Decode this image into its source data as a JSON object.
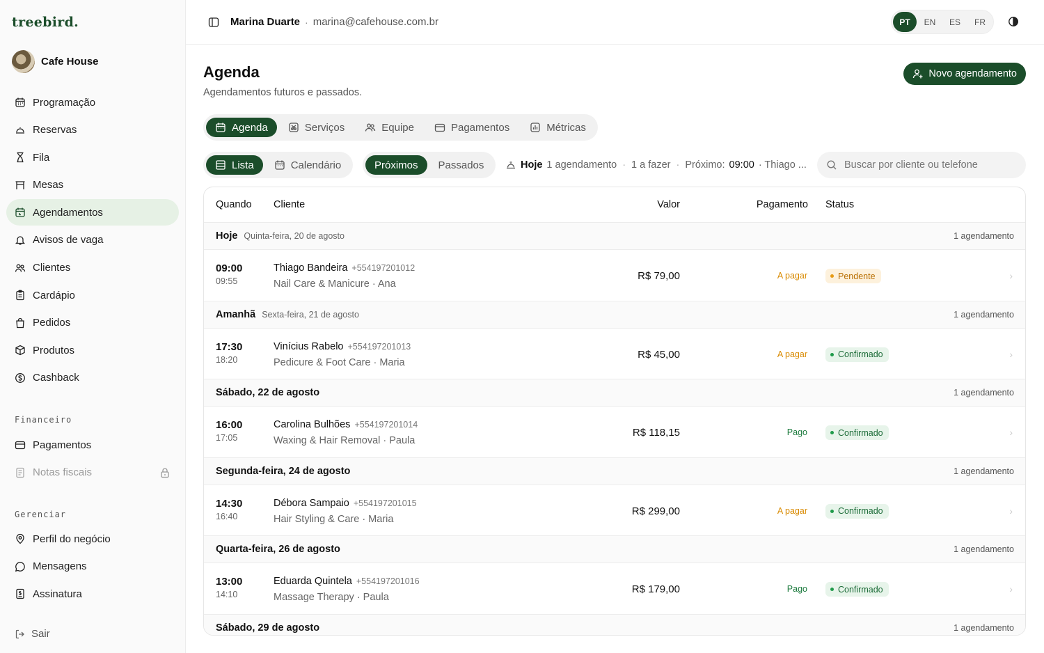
{
  "brand": {
    "logo": "treebird.",
    "business": "Cafe House"
  },
  "colors": {
    "brand": "#1b4d2a",
    "active_bg": "#e6f1e5",
    "pending": "#d98a00",
    "pending_bg": "#fdf1dc",
    "confirmed": "#1b7a3d",
    "confirmed_bg": "#e7f4ea",
    "paid": "#1b7a3d",
    "to_pay": "#d98a00"
  },
  "sidebar": {
    "items": [
      {
        "label": "Programação",
        "icon": "calendar-icon"
      },
      {
        "label": "Reservas",
        "icon": "cloche-icon"
      },
      {
        "label": "Fila",
        "icon": "hourglass-icon"
      },
      {
        "label": "Mesas",
        "icon": "table-icon"
      },
      {
        "label": "Agendamentos",
        "icon": "calendar-clock-icon"
      },
      {
        "label": "Avisos de vaga",
        "icon": "bell-icon"
      },
      {
        "label": "Clientes",
        "icon": "users-icon"
      },
      {
        "label": "Cardápio",
        "icon": "clipboard-icon"
      },
      {
        "label": "Pedidos",
        "icon": "bag-icon"
      },
      {
        "label": "Produtos",
        "icon": "box-icon"
      },
      {
        "label": "Cashback",
        "icon": "coin-icon"
      }
    ],
    "finance_label": "Financeiro",
    "finance": [
      {
        "label": "Pagamentos",
        "icon": "wallet-icon"
      },
      {
        "label": "Notas fiscais",
        "icon": "receipt-icon"
      }
    ],
    "manage_label": "Gerenciar",
    "manage": [
      {
        "label": "Perfil do negócio",
        "icon": "location-icon"
      },
      {
        "label": "Mensagens",
        "icon": "chat-icon"
      },
      {
        "label": "Assinatura",
        "icon": "subscription-icon"
      }
    ],
    "logout": "Sair"
  },
  "topbar": {
    "user": "Marina Duarte",
    "sep": "·",
    "email": "marina@cafehouse.com.br",
    "langs": [
      "PT",
      "EN",
      "ES",
      "FR"
    ],
    "active_lang": "PT"
  },
  "page": {
    "title": "Agenda",
    "subtitle": "Agendamentos futuros e passados.",
    "new_button": "Novo agendamento"
  },
  "tabs": [
    "Agenda",
    "Serviços",
    "Equipe",
    "Pagamentos",
    "Métricas"
  ],
  "view": {
    "list": "Lista",
    "calendar": "Calendário"
  },
  "period": {
    "upcoming": "Próximos",
    "past": "Passados"
  },
  "summary": {
    "today": "Hoje",
    "count": "1 agendamento",
    "todo": "1 a fazer",
    "next_label": "Próximo:",
    "next_time": "09:00",
    "next_rest": "· Thiago ..."
  },
  "search": {
    "placeholder": "Buscar por cliente ou telefone"
  },
  "table": {
    "headers": {
      "when": "Quando",
      "client": "Cliente",
      "value": "Valor",
      "payment": "Pagamento",
      "status": "Status"
    },
    "groups": [
      {
        "day": "Hoje",
        "date": "Quinta-feira, 20 de agosto",
        "count": "1 agendamento",
        "rows": [
          {
            "start": "09:00",
            "end": "09:55",
            "client": "Thiago Bandeira",
            "phone": "+554197201012",
            "service": "Nail Care & Manicure · Ana",
            "value": "R$ 79,00",
            "payment": "A pagar",
            "status": "Pendente"
          }
        ]
      },
      {
        "day": "Amanhã",
        "date": "Sexta-feira, 21 de agosto",
        "count": "1 agendamento",
        "rows": [
          {
            "start": "17:30",
            "end": "18:20",
            "client": "Vinícius Rabelo",
            "phone": "+554197201013",
            "service": "Pedicure & Foot Care · Maria",
            "value": "R$ 45,00",
            "payment": "A pagar",
            "status": "Confirmado"
          }
        ]
      },
      {
        "day": "Sábado, 22 de agosto",
        "date": "",
        "count": "1 agendamento",
        "rows": [
          {
            "start": "16:00",
            "end": "17:05",
            "client": "Carolina Bulhões",
            "phone": "+554197201014",
            "service": "Waxing & Hair Removal · Paula",
            "value": "R$ 118,15",
            "payment": "Pago",
            "status": "Confirmado"
          }
        ]
      },
      {
        "day": "Segunda-feira, 24 de agosto",
        "date": "",
        "count": "1 agendamento",
        "rows": [
          {
            "start": "14:30",
            "end": "16:40",
            "client": "Débora Sampaio",
            "phone": "+554197201015",
            "service": "Hair Styling & Care · Maria",
            "value": "R$ 299,00",
            "payment": "A pagar",
            "status": "Confirmado"
          }
        ]
      },
      {
        "day": "Quarta-feira, 26 de agosto",
        "date": "",
        "count": "1 agendamento",
        "rows": [
          {
            "start": "13:00",
            "end": "14:10",
            "client": "Eduarda Quintela",
            "phone": "+554197201016",
            "service": "Massage Therapy · Paula",
            "value": "R$ 179,00",
            "payment": "Pago",
            "status": "Confirmado"
          }
        ]
      },
      {
        "day": "Sábado, 29 de agosto",
        "date": "",
        "count": "1 agendamento",
        "rows": []
      }
    ]
  }
}
